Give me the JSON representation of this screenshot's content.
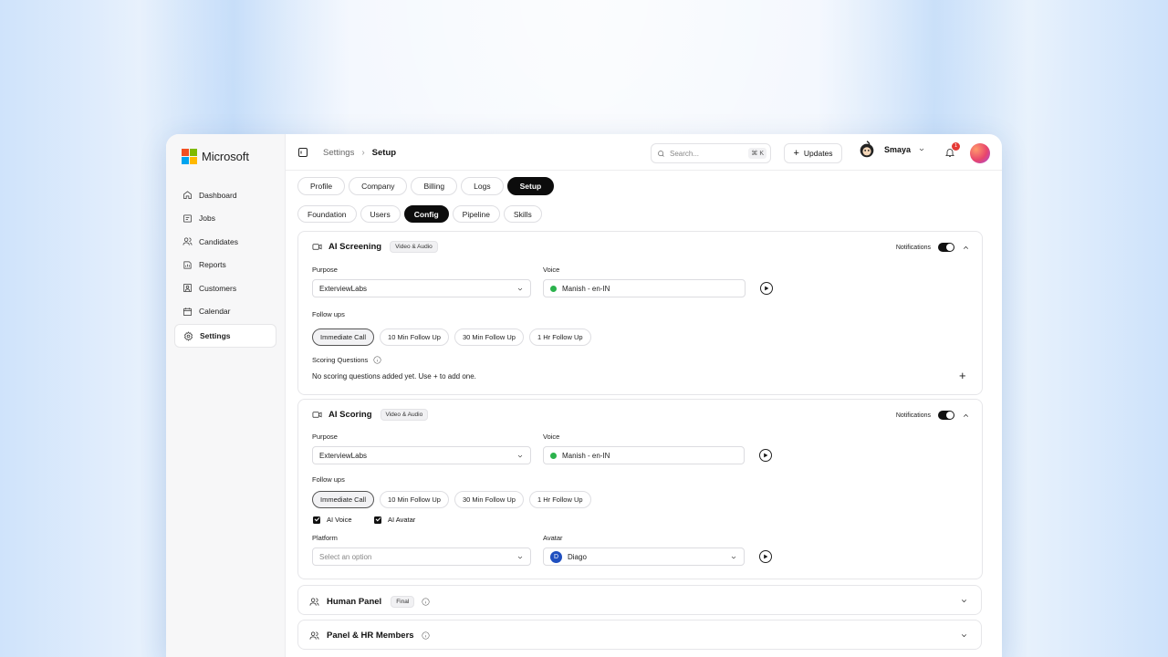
{
  "brand": {
    "name": "Microsoft"
  },
  "sidebar": {
    "items": [
      {
        "label": "Dashboard",
        "icon": "home-icon"
      },
      {
        "label": "Jobs",
        "icon": "briefcase-icon"
      },
      {
        "label": "Candidates",
        "icon": "users-icon"
      },
      {
        "label": "Reports",
        "icon": "chart-icon"
      },
      {
        "label": "Customers",
        "icon": "contacts-icon"
      },
      {
        "label": "Calendar",
        "icon": "calendar-icon"
      },
      {
        "label": "Settings",
        "icon": "gear-icon",
        "active": true
      }
    ]
  },
  "topbar": {
    "breadcrumb": [
      "Settings",
      "Setup"
    ],
    "search_placeholder": "Search...",
    "search_shortcut": "⌘ K",
    "updates_label": "Updates",
    "user_name": "Smaya",
    "notification_count": "1"
  },
  "tabs_primary": [
    "Profile",
    "Company",
    "Billing",
    "Logs",
    "Setup"
  ],
  "tabs_primary_active": "Setup",
  "tabs_secondary": [
    "Foundation",
    "Users",
    "Config",
    "Pipeline",
    "Skills"
  ],
  "tabs_secondary_active": "Config",
  "screening": {
    "title": "AI Screening",
    "tag": "Video & Audio",
    "notifications_label": "Notifications",
    "purpose_label": "Purpose",
    "purpose_value": "ExterviewLabs",
    "voice_label": "Voice",
    "voice_value": "Manish - en-IN",
    "followups_label": "Follow ups",
    "followups": [
      "Immediate Call",
      "10 Min Follow Up",
      "30 Min Follow Up",
      "1 Hr Follow Up"
    ],
    "scoring_label": "Scoring Questions",
    "scoring_empty": "No scoring questions added yet. Use + to add one."
  },
  "scoring": {
    "title": "AI Scoring",
    "tag": "Video & Audio",
    "notifications_label": "Notifications",
    "purpose_label": "Purpose",
    "purpose_value": "ExterviewLabs",
    "voice_label": "Voice",
    "voice_value": "Manish - en-IN",
    "followups_label": "Follow ups",
    "followups": [
      "Immediate Call",
      "10 Min Follow Up",
      "30 Min Follow Up",
      "1 Hr Follow Up"
    ],
    "ai_voice_label": "AI Voice",
    "ai_avatar_label": "AI Avatar",
    "platform_label": "Platform",
    "platform_placeholder": "Select an option",
    "avatar_label": "Avatar",
    "avatar_initial": "D",
    "avatar_value": "Diago"
  },
  "human_panel": {
    "title": "Human Panel",
    "tag": "Final"
  },
  "panel_hr": {
    "title": "Panel & HR Members"
  }
}
